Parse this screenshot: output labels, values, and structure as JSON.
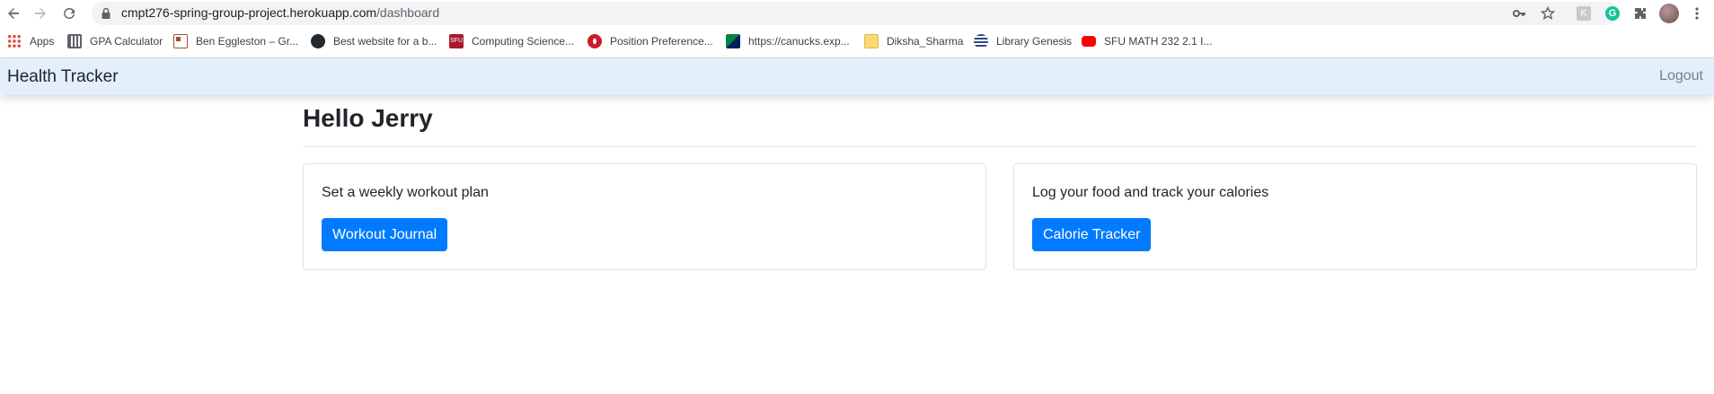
{
  "browser": {
    "url_host": "cmpt276-spring-group-project.herokuapp.com",
    "url_path": "/dashboard",
    "bookmarks": [
      {
        "label": "Apps",
        "icon": "apps-grid-icon",
        "color": "#ea4335"
      },
      {
        "label": "GPA Calculator",
        "icon": "calculator-icon",
        "color": "#5f6368"
      },
      {
        "label": "Ben Eggleston – Gr...",
        "icon": "page-icon",
        "color": "#a0522d"
      },
      {
        "label": "Best website for a b...",
        "icon": "github-icon",
        "color": "#24292e"
      },
      {
        "label": "Computing Science...",
        "icon": "sfu-icon",
        "color": "#a6192e"
      },
      {
        "label": "Position Preference...",
        "icon": "opera-icon",
        "color": "#cc1b2a"
      },
      {
        "label": "https://canucks.exp...",
        "icon": "canucks-icon",
        "color": "#00843d"
      },
      {
        "label": "Diksha_Sharma",
        "icon": "folder-icon",
        "color": "#f2c94c"
      },
      {
        "label": "Library Genesis",
        "icon": "library-icon",
        "color": "#2b4c7e"
      },
      {
        "label": "SFU MATH 232 2.1 I...",
        "icon": "youtube-icon",
        "color": "#ff0000"
      }
    ]
  },
  "app": {
    "brand": "Health Tracker",
    "logout": "Logout",
    "greeting": "Hello Jerry",
    "cards": [
      {
        "text": "Set a weekly workout plan",
        "button": "Workout Journal"
      },
      {
        "text": "Log your food and track your calories",
        "button": "Calorie Tracker"
      }
    ],
    "accent_color": "#007bff"
  }
}
